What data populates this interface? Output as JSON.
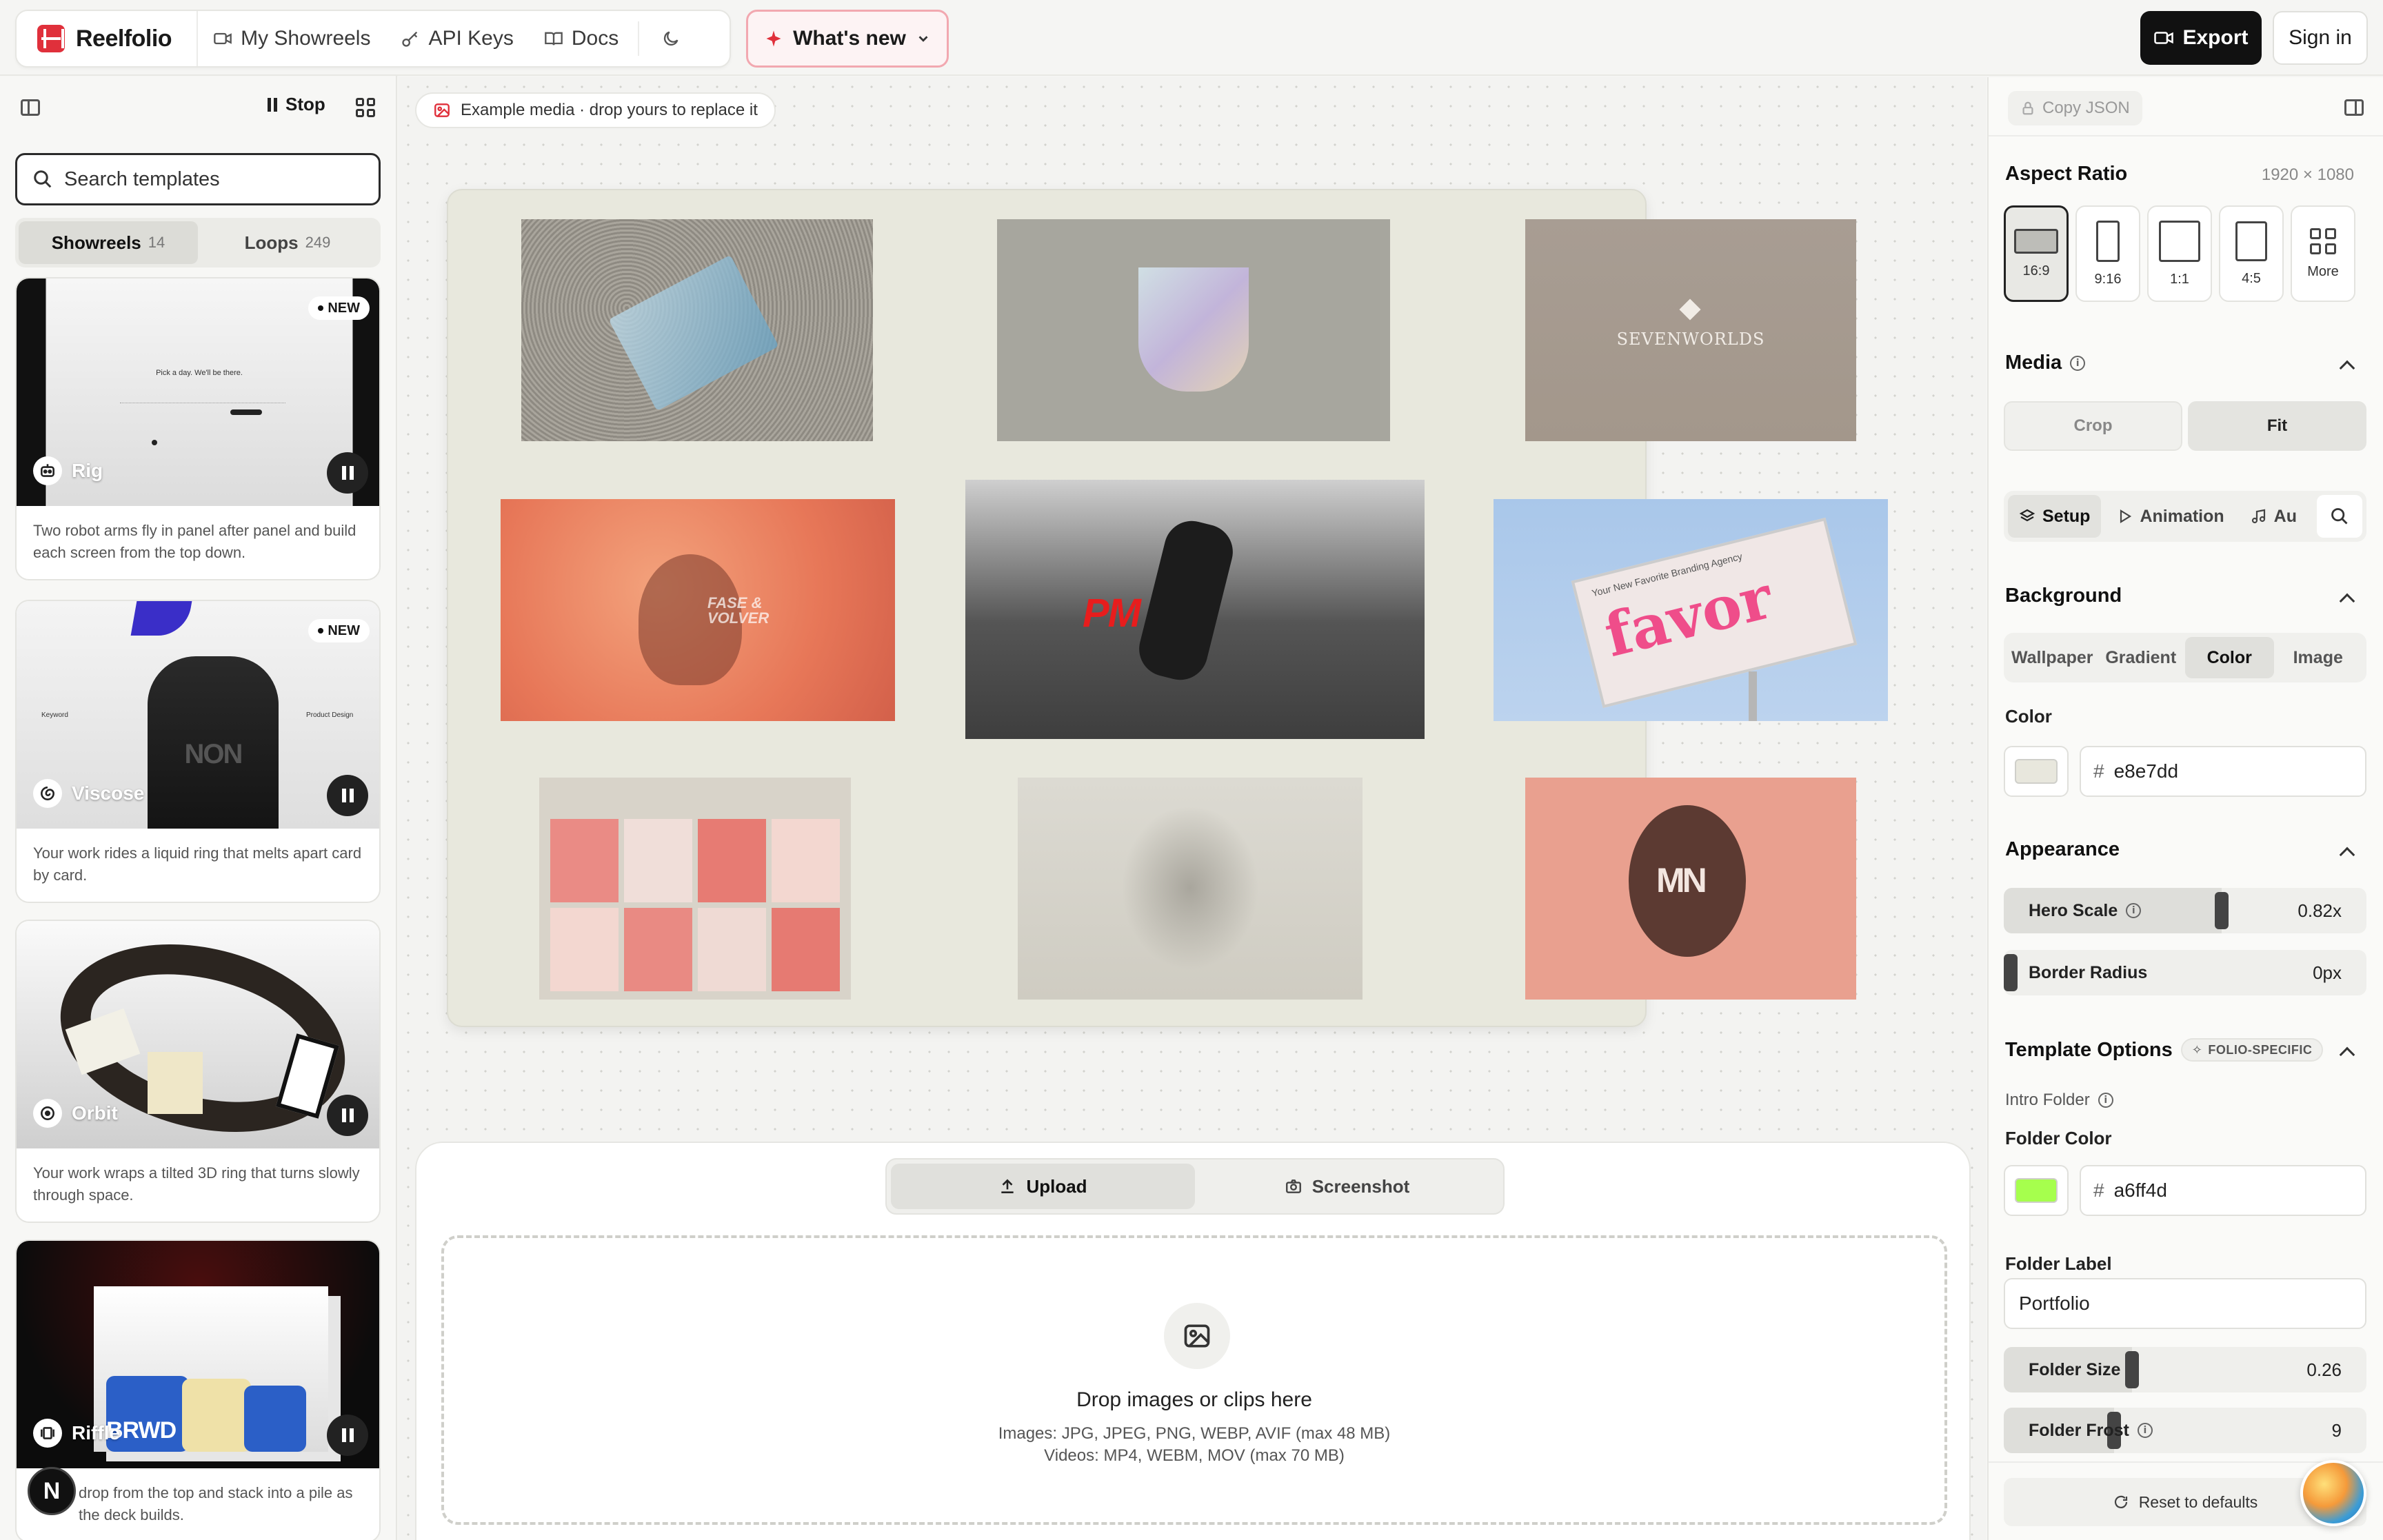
{
  "app": {
    "name": "Reelfolio",
    "nav": {
      "showreels": "My Showreels",
      "api_keys": "API Keys",
      "docs": "Docs"
    },
    "whats_new": "What's new",
    "export": "Export",
    "sign_in": "Sign in"
  },
  "sidebar": {
    "stop": "Stop",
    "search_placeholder": "Search templates",
    "tabs": [
      {
        "label": "Showreels",
        "count": "14"
      },
      {
        "label": "Loops",
        "count": "249"
      }
    ],
    "cards": [
      {
        "name": "Rig",
        "badge": "NEW",
        "thumb_text": "Pick a day. We'll be there.",
        "desc": "Two robot arms fly in panel after panel and build each screen from the top down."
      },
      {
        "name": "Viscose",
        "badge": "NEW",
        "thumb_text": "NON",
        "thumb_left": "Keyword",
        "thumb_right": "Product Design",
        "desc": "Your work rides a liquid ring that melts apart card by card."
      },
      {
        "name": "Orbit",
        "desc": "Your work wraps a tilted 3D ring that turns slowly through space."
      },
      {
        "name": "Riffle",
        "thumb_text": "BRWD",
        "desc": "drop from the top and stack into a pile as the deck builds."
      }
    ],
    "avatar": "N"
  },
  "canvas": {
    "example_note": "Example media · drop yours to replace it",
    "tiles": {
      "brand_left": "SEVENWORLDS",
      "fase": "FASE & VOLVER",
      "billboard_small": "Your New Favorite Branding Agency",
      "billboard_big": "favor",
      "pm": "PM",
      "mn": "MN"
    },
    "upload": {
      "tab_upload": "Upload",
      "tab_screenshot": "Screenshot",
      "drop_title": "Drop images or clips here",
      "images_note": "Images: JPG, JPEG, PNG, WEBP, AVIF (max 48 MB)",
      "videos_note": "Videos: MP4, WEBM, MOV (max 70 MB)"
    }
  },
  "panel": {
    "copy_json": "Copy JSON",
    "aspect_ratio": {
      "title": "Aspect Ratio",
      "resolution": "1920 × 1080",
      "options": [
        "16:9",
        "9:16",
        "1:1",
        "4:5",
        "More"
      ]
    },
    "media": {
      "title": "Media",
      "crop": "Crop",
      "fit": "Fit"
    },
    "tabs": {
      "setup": "Setup",
      "animation": "Animation",
      "audio": "Au"
    },
    "background": {
      "title": "Background",
      "tabs": [
        "Wallpaper",
        "Gradient",
        "Color",
        "Image"
      ],
      "color_label": "Color",
      "color_hex": "e8e7dd",
      "color_value": "#e8e7dd"
    },
    "appearance": {
      "title": "Appearance",
      "hero_scale_label": "Hero Scale",
      "hero_scale_value": "0.82x",
      "hero_scale_level": 0.82,
      "border_radius_label": "Border Radius",
      "border_radius_value": "0px",
      "border_radius_level": 0
    },
    "template_options": {
      "title": "Template Options",
      "badge": "FOLIO-SPECIFIC",
      "intro_folder": "Intro Folder",
      "folder_color_label": "Folder Color",
      "folder_color_hex": "a6ff4d",
      "folder_color_value": "#a6ff4d",
      "folder_label_label": "Folder Label",
      "folder_label_value": "Portfolio",
      "folder_size_label": "Folder Size",
      "folder_size_value": "0.26",
      "folder_size_level": 0.26,
      "folder_frost_label": "Folder Frost",
      "folder_frost_value": "9",
      "folder_frost_level": 0.24
    },
    "reset": "Reset to defaults"
  },
  "colors": {
    "accent_red": "#e0303b",
    "board_bg": "#e8e7dd",
    "folder_green": "#a6ff4d"
  }
}
